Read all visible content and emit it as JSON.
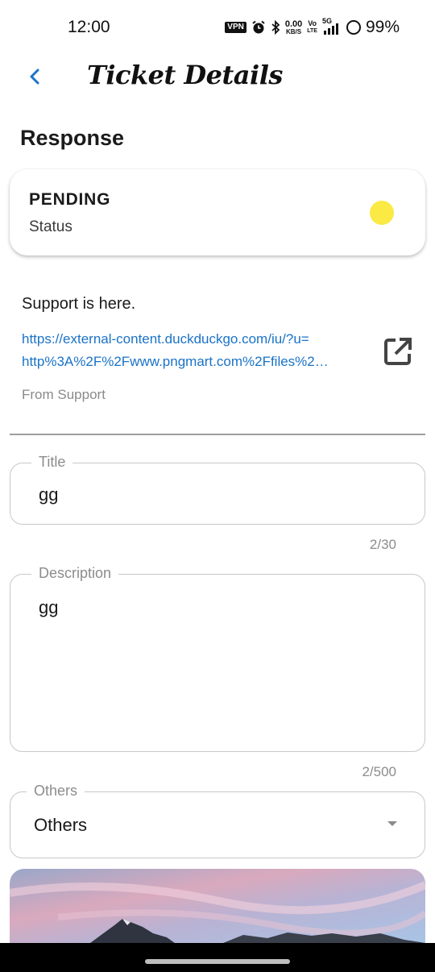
{
  "status_bar": {
    "time": "12:00",
    "vpn": "VPN",
    "net_speed_top": "0.00",
    "net_speed_bottom": "KB/S",
    "volte_top": "Vo",
    "volte_bottom": "LTE",
    "network": "5G",
    "battery": "99%"
  },
  "app_bar": {
    "title": "Ticket Details"
  },
  "response": {
    "heading": "Response",
    "status_value": "PENDING",
    "status_label": "Status",
    "status_color": "#fbe944",
    "message": "Support is here.",
    "link_line1": "https://external-content.duckduckgo.com/iu/?u=",
    "link_line2": "http%3A%2F%2Fwww.pngmart.com%2Ffiles%2…",
    "from": "From Support"
  },
  "form": {
    "title": {
      "label": "Title",
      "value": "gg",
      "counter": "2/30"
    },
    "description": {
      "label": "Description",
      "value": "gg",
      "counter": "2/500"
    },
    "category": {
      "label": "Others",
      "value": "Others"
    }
  },
  "colors": {
    "accent": "#1a73c7",
    "pending": "#fbe944"
  }
}
